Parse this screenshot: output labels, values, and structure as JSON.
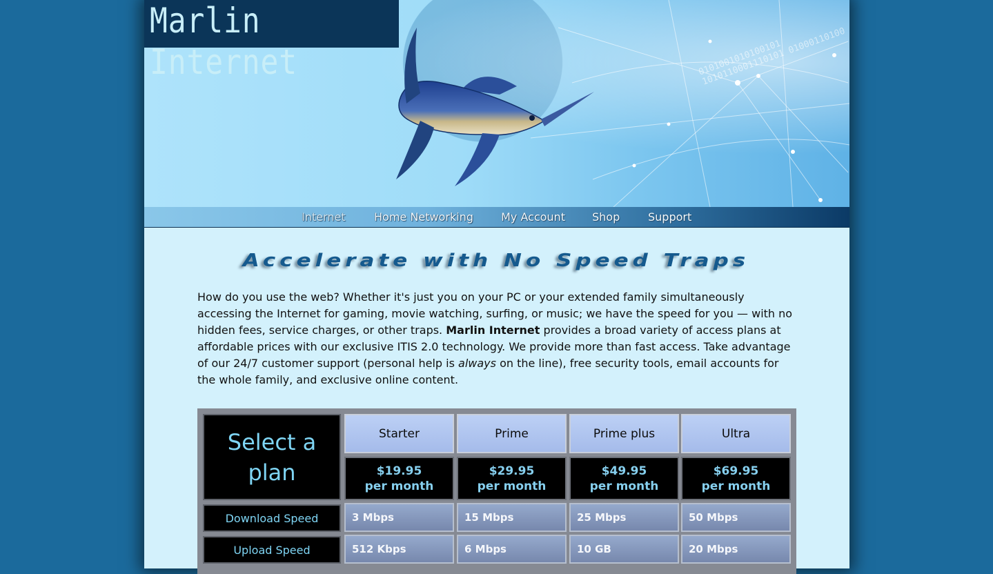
{
  "header": {
    "logo_text": "Marlin Internet",
    "binary_text": "0101001010100101 1010110001110101 01000110100"
  },
  "nav": {
    "items": [
      {
        "label": "Internet"
      },
      {
        "label": "Home Networking"
      },
      {
        "label": "My Account"
      },
      {
        "label": "Shop"
      },
      {
        "label": "Support"
      }
    ],
    "active": "Internet"
  },
  "main": {
    "heading": "Accelerate with No Speed Traps",
    "intro_part1": "How do you use the web? Whether it's just you on your PC or your extended family simultaneously accessing the Internet for gaming, movie watching, surfing, or music; we have the speed for you — with no hidden fees, service charges, or other traps. ",
    "intro_brand": "Marlin Internet",
    "intro_part2": " provides a broad variety of access plans at affordable prices with our exclusive ITIS 2.0 technology. We provide more than fast access. Take advantage of our 24/7 customer support (personal help is ",
    "intro_emph": "always",
    "intro_part3": " on the line), free security tools, email accounts for the whole family, and exclusive online content."
  },
  "plans": {
    "select_label": "Select a plan",
    "columns": [
      {
        "name": "Starter",
        "price": "$19.95",
        "period": "per month",
        "download": "3 Mbps",
        "upload": "512 Kbps"
      },
      {
        "name": "Prime",
        "price": "$29.95",
        "period": "per month",
        "download": "15 Mbps",
        "upload": "6 Mbps"
      },
      {
        "name": "Prime plus",
        "price": "$49.95",
        "period": "per month",
        "download": "25 Mbps",
        "upload": "10 GB"
      },
      {
        "name": "Ultra",
        "price": "$69.95",
        "period": "per month",
        "download": "50 Mbps",
        "upload": "20 Mbps"
      }
    ],
    "rows": {
      "download_label": "Download Speed",
      "upload_label": "Upload Speed"
    }
  },
  "colors": {
    "background": "#1b6a9c",
    "page": "#d3f1fc",
    "accent": "#7fd5f4",
    "heading": "#155a8e"
  }
}
